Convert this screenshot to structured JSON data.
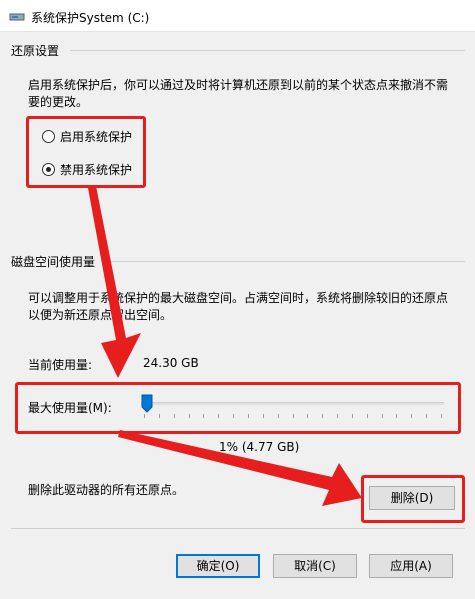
{
  "window": {
    "title": "系统保护System (C:)"
  },
  "restore": {
    "heading": "还原设置",
    "description_line1": "启用系统保护后，你可以通过及时将计算机还原到以前的某个状态点来撤消不需",
    "description_line2": "要的更改。",
    "options": [
      {
        "label": "启用系统保护",
        "selected": false
      },
      {
        "label": "禁用系统保护",
        "selected": true
      }
    ]
  },
  "disk": {
    "heading": "磁盘空间使用量",
    "description_line1": "可以调整用于系统保护的最大磁盘空间。占满空间时，系统将删除较旧的还原点",
    "description_line2": "以便为新还原点留出空间。",
    "current_label": "当前使用量:",
    "current_value": "24.30 GB",
    "max_label": "最大使用量(M):",
    "max_percent": 1,
    "max_value_text": "1% (4.77 GB)"
  },
  "delete": {
    "text": "删除此驱动器的所有还原点。",
    "button": "删除(D)"
  },
  "buttons": {
    "ok": "确定(O)",
    "cancel": "取消(C)",
    "apply": "应用(A)"
  },
  "colors": {
    "annotation": "#e61e1e",
    "accent": "#0078d7",
    "background": "#f0f0f0"
  }
}
